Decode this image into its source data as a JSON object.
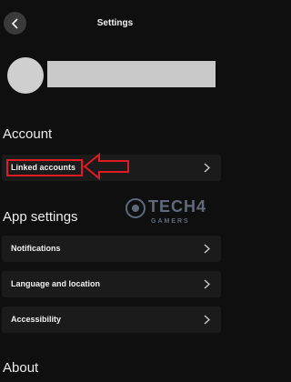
{
  "header": {
    "title": "Settings",
    "back_icon": "chevron-left-icon"
  },
  "profile": {
    "avatar": "avatar",
    "name_redacted": true
  },
  "sections": {
    "account": "Account",
    "app_settings": "App settings",
    "about": "About"
  },
  "rows": {
    "linked_accounts": "Linked accounts",
    "notifications": "Notifications",
    "language_location": "Language and location",
    "accessibility": "Accessibility"
  },
  "annotation": {
    "color": "#e01b24"
  },
  "watermark": {
    "line1": "TECH4",
    "line2": "GAMERS"
  },
  "colors": {
    "background": "#0f0f0f",
    "row": "#1b1b1b",
    "highlight": "#e01b24"
  }
}
